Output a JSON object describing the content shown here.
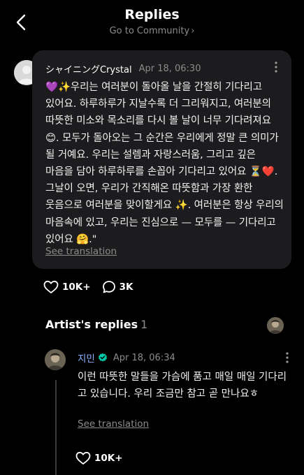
{
  "header": {
    "title": "Replies",
    "subtitle": "Go to Community",
    "back_icon": "chevron-left-icon",
    "subtitle_icon": "chevron-right-icon"
  },
  "fan_comment": {
    "author": "シャイニングCrystal",
    "timestamp": "Apr 18, 06:30",
    "body": "💜✨우리는 여러분이 돌아올 날을 간절히 기다리고 있어요. 하루하루가 지날수록 더 그리워지고, 여러분의 따뜻한 미소와 목소리를 다시 볼 날이 너무 기다려져요 😊. 모두가 돌아오는 그 순간은 우리에게 정말 큰 의미가 될 거예요. 우리는 설렘과 자랑스러움, 그리고 깊은 마음을 담아 하루하루를 손꼽아 기다리고 있어요 ⏳❤️. 그날이 오면, 우리가 간직해온 따뜻함과 가장 환한 웃음으로 여러분을 맞이할게요 ✨. 여러분은 항상 우리의 마음속에 있고, 우리는 진심으로 — 모두를 — 기다리고 있어요 🤗.\"",
    "see_translation": "See translation",
    "more_icon": "more-vertical-icon"
  },
  "reactions": {
    "likes": "10K+",
    "replies": "3K",
    "like_icon": "heart-outline-icon",
    "reply_icon": "speech-bubble-icon"
  },
  "artist_replies": {
    "heading": "Artist's replies",
    "count": "1"
  },
  "artist_reply": {
    "author": "지민",
    "verified_icon": "verified-badge-icon",
    "timestamp": "Apr 18, 06:34",
    "body": "이런 따뜻한 말들을 가슴에 품고 매일 매일 기다리고 있습니다. 우리 조금만 참고 곧 만나요ㅎ",
    "see_translation": "See translation",
    "likes": "10K+"
  },
  "colors": {
    "background": "#000000",
    "card": "#1c1c1e",
    "muted_text": "#8b8b8b",
    "artist_name": "#8ab4ff",
    "verified": "#00c8aa"
  }
}
